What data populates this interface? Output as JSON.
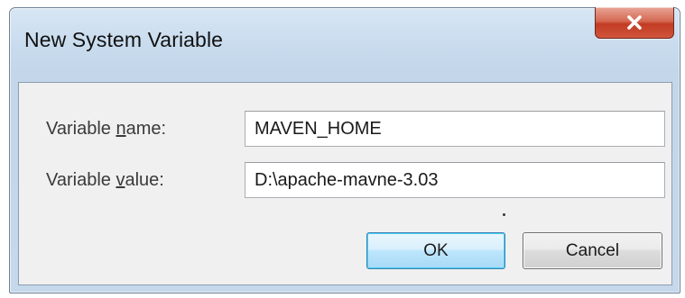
{
  "window": {
    "title": "New System Variable",
    "close_icon": "close-icon"
  },
  "form": {
    "name_label_prefix": "Variable ",
    "name_label_access": "n",
    "name_label_suffix": "ame:",
    "name_value": "MAVEN_HOME",
    "value_label_prefix": "Variable ",
    "value_label_access": "v",
    "value_label_suffix": "alue:",
    "value_value": "D:\\apache-mavne-3.03"
  },
  "buttons": {
    "ok_label": "OK",
    "cancel_label": "Cancel"
  },
  "colors": {
    "accent": "#3c7fb1",
    "close": "#c23b22"
  }
}
